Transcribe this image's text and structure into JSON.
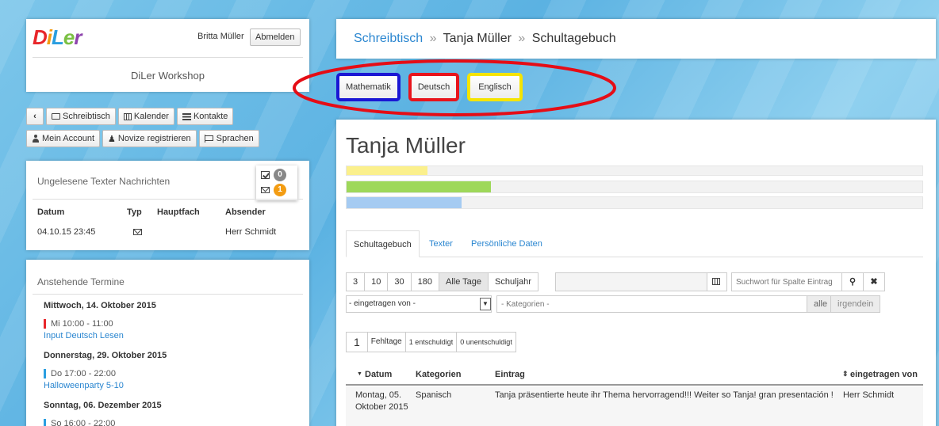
{
  "header": {
    "user_name": "Britta Müller",
    "logout_label": "Abmelden",
    "site_name": "DiLer Workshop"
  },
  "nav": {
    "back_icon": "chevron-left-icon",
    "desk_label": "Schreibtisch",
    "calendar_label": "Kalender",
    "contacts_label": "Kontakte",
    "account_label": "Mein Account",
    "novice_label": "Novize registrieren",
    "languages_label": "Sprachen"
  },
  "messages": {
    "title": "Ungelesene Texter Nachrichten",
    "read_count": "0",
    "unread_count": "1",
    "columns": [
      "Datum",
      "Typ",
      "Hauptfach",
      "Absender"
    ],
    "rows": [
      {
        "date": "04.10.15 23:45",
        "type": "mail-icon",
        "subject": "",
        "sender": "Herr Schmidt"
      }
    ]
  },
  "events": {
    "title": "Anstehende Termine",
    "days": [
      {
        "heading": "Mittwoch, 14. Oktober 2015",
        "time": "Mi 10:00 - 11:00",
        "name": "Input Deutsch Lesen",
        "color": "#e8262a"
      },
      {
        "heading": "Donnerstag, 29. Oktober 2015",
        "time": "Do 17:00 - 22:00",
        "name": "Halloweenparty 5-10",
        "color": "#2a9ee0"
      },
      {
        "heading": "Sonntag, 06. Dezember 2015",
        "time": "So 16:00 - 22:00",
        "name": "",
        "color": "#2a9ee0"
      }
    ]
  },
  "breadcrumb": {
    "desk": "Schreibtisch",
    "sep1": "»",
    "student": "Tanja Müller",
    "sep2": "»",
    "page": "Schultagebuch"
  },
  "subjects": [
    {
      "label": "Mathematik",
      "highlight": "#1a17d4"
    },
    {
      "label": "Deutsch",
      "highlight": "#e8141c"
    },
    {
      "label": "Englisch",
      "highlight": "#f5e400"
    }
  ],
  "annotation_color": "#e50d16",
  "student": {
    "name": "Tanja Müller",
    "progress": [
      {
        "fraction": 0.14,
        "color": "#fbf08c"
      },
      {
        "fraction": 0.25,
        "color": "#9ed85a"
      },
      {
        "fraction": 0.2,
        "color": "#a5cbf2"
      }
    ]
  },
  "tabs": [
    "Schultagebuch",
    "Texter",
    "Persönliche Daten"
  ],
  "filters": {
    "ranges": [
      "3",
      "10",
      "30",
      "180",
      "Alle Tage",
      "Schuljahr"
    ],
    "active_range": "Alle Tage",
    "date_value": "",
    "search_placeholder": "Suchwort für Spalte Eintrag",
    "author_select": "- eingetragen von -",
    "category_placeholder": "- Kategorien -",
    "match_all": "alle",
    "match_any": "irgendein"
  },
  "stats": {
    "count": "1",
    "absent_label": "Fehltage",
    "excused": "1 entschuldigt",
    "unexcused": "0 unentschuldigt"
  },
  "table": {
    "columns": [
      "Datum",
      "Kategorien",
      "Eintrag",
      "eingetragen von"
    ],
    "rows": [
      {
        "date_line1": "Montag, 05.",
        "date_line2": "Oktober 2015",
        "category": "Spanisch",
        "entry": "Tanja präsentierte heute ihr Thema hervorragend!!! Weiter so Tanja! gran presentación !",
        "author": "Herr Schmidt"
      }
    ]
  }
}
